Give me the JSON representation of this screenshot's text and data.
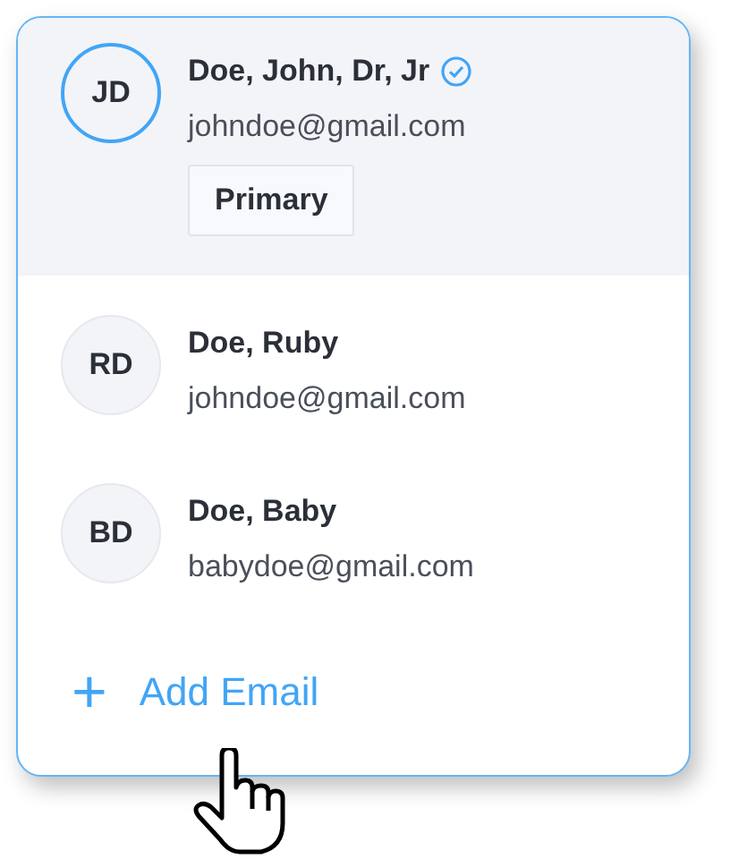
{
  "contacts": [
    {
      "initials": "JD",
      "name": "Doe, John, Dr, Jr",
      "verified": true,
      "email": "johndoe@gmail.com",
      "badge": "Primary",
      "selected": true
    },
    {
      "initials": "RD",
      "name": "Doe, Ruby",
      "verified": false,
      "email": "johndoe@gmail.com",
      "selected": false
    },
    {
      "initials": "BD",
      "name": "Doe, Baby",
      "verified": false,
      "email": "babydoe@gmail.com",
      "selected": false
    }
  ],
  "add_button": {
    "icon": "+",
    "label": "Add Email"
  }
}
